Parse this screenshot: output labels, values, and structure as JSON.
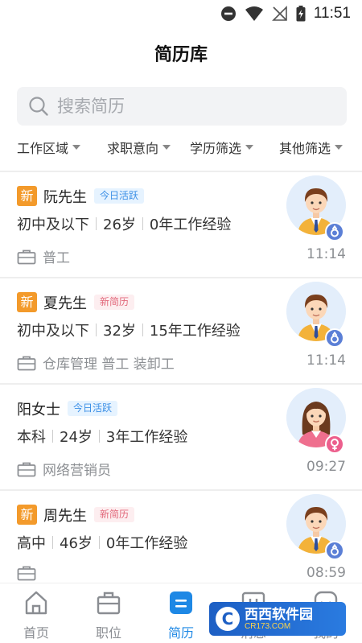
{
  "status_bar": {
    "time": "11:51"
  },
  "title": "简历库",
  "search": {
    "placeholder": "搜索简历"
  },
  "filters": [
    {
      "label": "工作区域"
    },
    {
      "label": "求职意向"
    },
    {
      "label": "学历筛选"
    },
    {
      "label": "其他筛选"
    }
  ],
  "candidates": [
    {
      "new_badge": "新",
      "name": "阮先生",
      "tag": "今日活跃",
      "education": "初中及以下",
      "age": "26岁",
      "experience": "0年工作经验",
      "job": "普工",
      "time": "11:14",
      "gender": "male"
    },
    {
      "new_badge": "新",
      "name": "夏先生",
      "tag": "新简历",
      "education": "初中及以下",
      "age": "32岁",
      "experience": "15年工作经验",
      "job": "仓库管理 普工 装卸工",
      "time": "11:14",
      "gender": "male"
    },
    {
      "new_badge": "",
      "name": "阳女士",
      "tag": "今日活跃",
      "education": "本科",
      "age": "24岁",
      "experience": "3年工作经验",
      "job": "网络营销员",
      "time": "09:27",
      "gender": "female"
    },
    {
      "new_badge": "新",
      "name": "周先生",
      "tag": "新简历",
      "education": "高中",
      "age": "46岁",
      "experience": "0年工作经验",
      "job": "",
      "time": "08:59",
      "gender": "male"
    }
  ],
  "tabs": [
    {
      "label": "首页"
    },
    {
      "label": "职位"
    },
    {
      "label": "简历"
    },
    {
      "label": "消息"
    },
    {
      "label": "我的"
    }
  ],
  "active_tab": "简历",
  "watermark": {
    "text": "西西软件园",
    "sub": "CR173.COM"
  },
  "colors": {
    "accent": "#1e88e5",
    "new_badge": "#f39a2b",
    "active_tag": "#3b8fe6",
    "new_tag": "#e26a7c"
  }
}
